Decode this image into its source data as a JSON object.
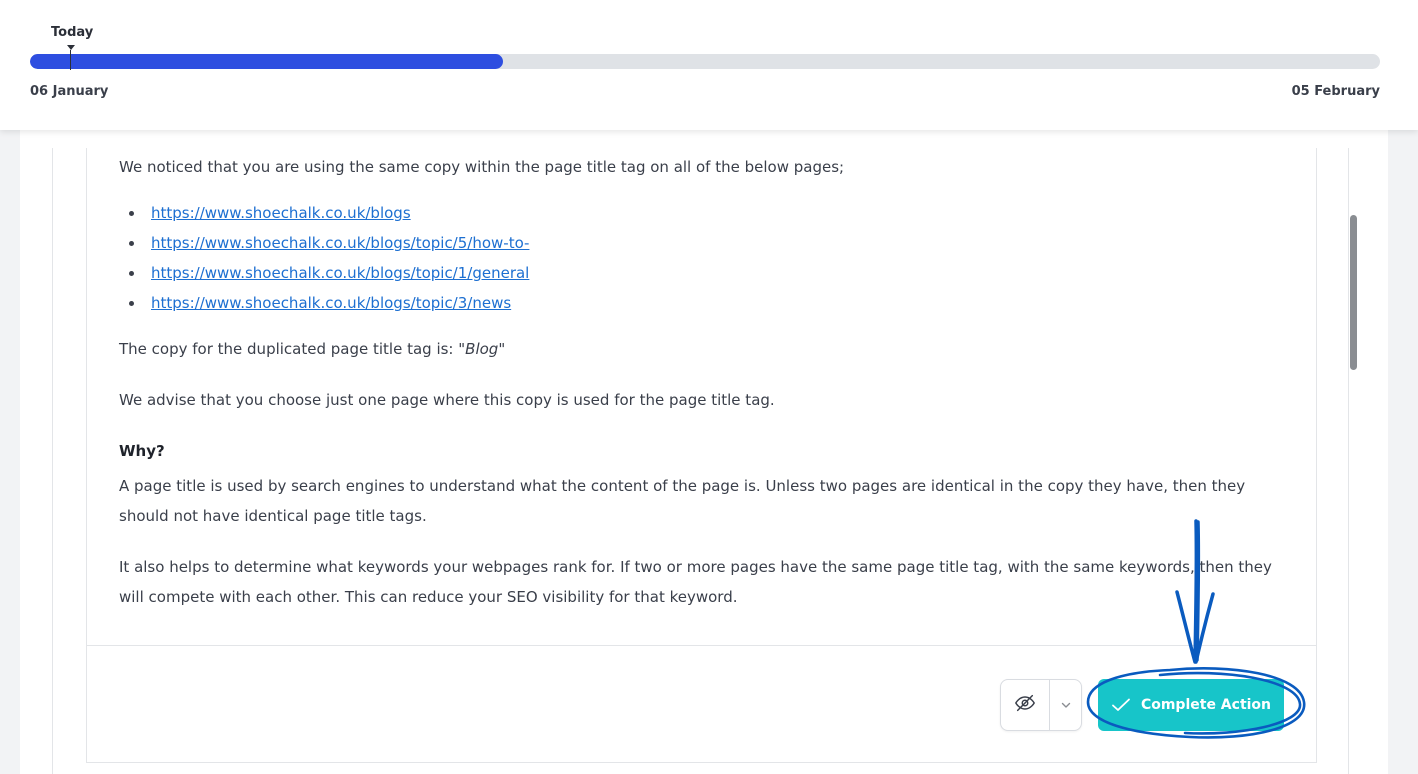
{
  "timeline": {
    "today_label": "Today",
    "start_label": "06 January",
    "end_label": "05 February",
    "progress": 0.35,
    "accent_color": "#2e4ee0"
  },
  "content": {
    "intro": "We noticed that you are using the same copy within the page title tag on all of the below pages;",
    "links": [
      "https://www.shoechalk.co.uk/blogs",
      "https://www.shoechalk.co.uk/blogs/topic/5/how-to-",
      "https://www.shoechalk.co.uk/blogs/topic/1/general",
      "https://www.shoechalk.co.uk/blogs/topic/3/news"
    ],
    "duplicate_prefix": "The copy for the duplicated page title tag is: \"",
    "duplicate_value": "Blog",
    "duplicate_suffix": "\"",
    "advice": "We advise that you choose just one page where this copy is used for the page title tag.",
    "why_heading": "Why?",
    "why_p1": "A page title is used by search engines to understand what the content of the page is. Unless two pages are identical in the copy they have, then they should not have identical page title tags.",
    "why_p2": "It also helps to determine what keywords your webpages rank for. If two or more pages have the same page title tag, with the same keywords, then they will compete with each other. This can reduce your SEO visibility for that keyword."
  },
  "actions": {
    "hide_icon": "eye-off-icon",
    "dropdown_icon": "chevron-down-icon",
    "complete_label": "Complete Action",
    "complete_icon": "check-icon",
    "complete_color": "#17c5c9"
  },
  "annotation": {
    "color": "#0a5bbf",
    "shapes": [
      "arrow-down",
      "ellipse"
    ]
  }
}
